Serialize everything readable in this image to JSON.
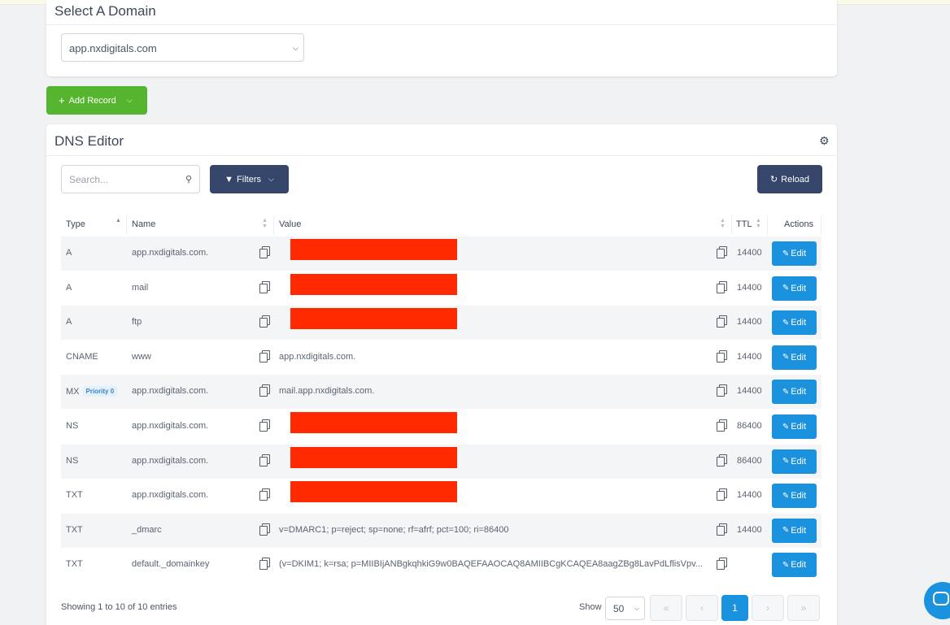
{
  "domain_card": {
    "title": "Select A Domain",
    "selected_domain": "app.nxdigitals.com"
  },
  "toolbar": {
    "add_record_label": "Add Record"
  },
  "dns_editor": {
    "title": "DNS Editor",
    "search_placeholder": "Search...",
    "filters_label": "Filters",
    "reload_label": "Reload",
    "columns": {
      "type": "Type",
      "name": "Name",
      "value": "Value",
      "ttl": "TTL",
      "actions": "Actions"
    },
    "edit_label": "Edit",
    "rows": [
      {
        "type": "A",
        "badge": "",
        "name": "app.nxdigitals.com.",
        "value": "",
        "redacted": true,
        "ttl": "14400"
      },
      {
        "type": "A",
        "badge": "",
        "name": "mail",
        "value": "",
        "redacted": true,
        "ttl": "14400"
      },
      {
        "type": "A",
        "badge": "",
        "name": "ftp",
        "value": "",
        "redacted": true,
        "ttl": "14400"
      },
      {
        "type": "CNAME",
        "badge": "",
        "name": "www",
        "value": "app.nxdigitals.com.",
        "redacted": false,
        "ttl": "14400"
      },
      {
        "type": "MX",
        "badge": "Priority 0",
        "name": "app.nxdigitals.com.",
        "value": "mail.app.nxdigitals.com.",
        "redacted": false,
        "ttl": "14400"
      },
      {
        "type": "NS",
        "badge": "",
        "name": "app.nxdigitals.com.",
        "value": "",
        "redacted": true,
        "ttl": "86400"
      },
      {
        "type": "NS",
        "badge": "",
        "name": "app.nxdigitals.com.",
        "value": "",
        "redacted": true,
        "ttl": "86400"
      },
      {
        "type": "TXT",
        "badge": "",
        "name": "app.nxdigitals.com.",
        "value": "",
        "redacted": true,
        "ttl": "14400"
      },
      {
        "type": "TXT",
        "badge": "",
        "name": "_dmarc",
        "value": "v=DMARC1; p=reject; sp=none; rf=afrf; pct=100; ri=86400",
        "redacted": false,
        "ttl": "14400"
      },
      {
        "type": "TXT",
        "badge": "",
        "name": "default._domainkey",
        "value": "(v=DKIM1; k=rsa; p=MIIBIjANBgkqhkiG9w0BAQEFAAOCAQ8AMIIBCgKCAQEA8aagZBg8LavPdLflisVpv...",
        "redacted": false,
        "ttl": ""
      }
    ],
    "footer": {
      "showing": "Showing 1 to 10 of 10 entries",
      "show_label": "Show",
      "per_page": "50",
      "pages": [
        "«",
        "‹",
        "1",
        "›",
        "»"
      ],
      "current_page": "1"
    }
  },
  "colors": {
    "add_button": "#56b52f",
    "dark_button": "#36466a",
    "edit_button": "#1b92de",
    "redaction": "#ff2a00"
  }
}
